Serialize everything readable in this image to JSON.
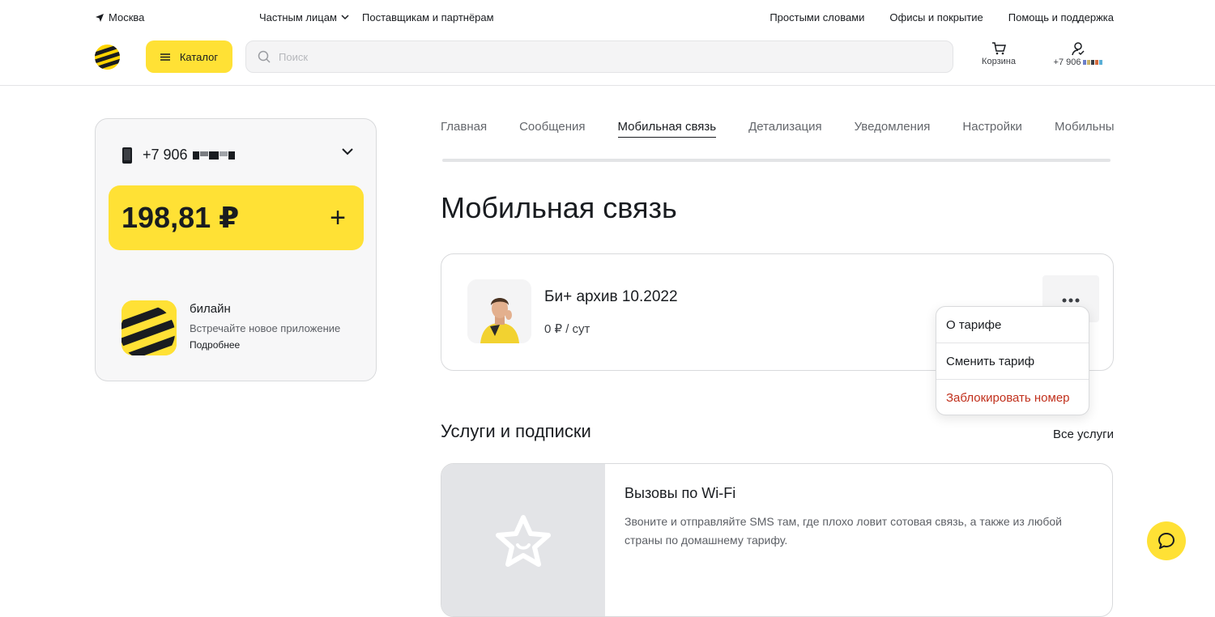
{
  "topbar": {
    "city": "Москва",
    "segments": [
      "Частным лицам",
      "Поставщикам и партнёрам"
    ],
    "links": [
      "Простыми словами",
      "Офисы и покрытие",
      "Помощь и поддержка"
    ]
  },
  "header": {
    "catalog_label": "Каталог",
    "search_placeholder": "Поиск",
    "cart_label": "Корзина",
    "phone_prefix": "+7 906"
  },
  "account": {
    "phone_prefix": "+7 906",
    "balance": "198,81 ₽",
    "promo": {
      "title": "билайн",
      "subtitle": "Встречайте новое приложение",
      "link": "Подробнее"
    }
  },
  "main": {
    "tabs": [
      "Главная",
      "Сообщения",
      "Мобильная связь",
      "Детализация",
      "Уведомления",
      "Настройки",
      "Мобильный ID"
    ],
    "active_tab": "Мобильная связь",
    "title": "Мобильная связь",
    "tariff": {
      "name": "Би+ архив 10.2022",
      "price": "0 ₽ / сут"
    },
    "menu": [
      "О тарифе",
      "Сменить тариф",
      "Заблокировать номер"
    ],
    "services_title": "Услуги и подписки",
    "all_services": "Все услуги",
    "service": {
      "name": "Вызовы по Wi-Fi",
      "description": "Звоните и отправляйте SMS там, где плохо ловит сотовая связь, а также из любой страны по домашнему тарифу."
    }
  },
  "colors": {
    "brand_yellow": "#ffe135",
    "danger": "#c1301c",
    "text": "#191c20"
  }
}
